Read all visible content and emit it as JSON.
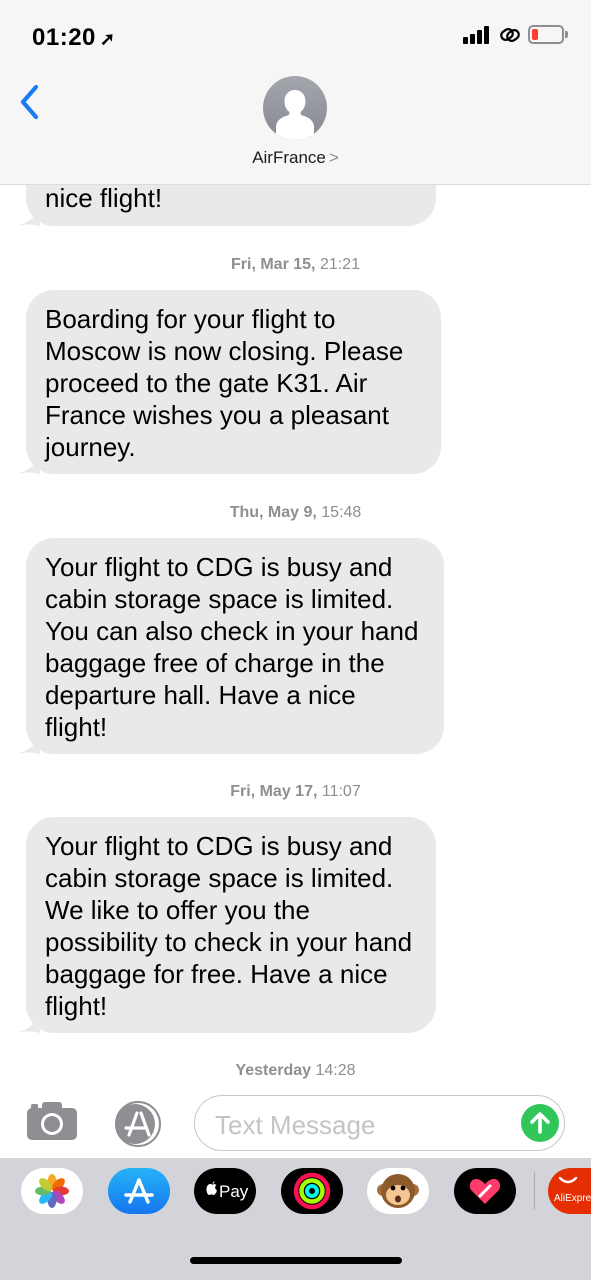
{
  "status_bar": {
    "time": "01:20",
    "location_arrow": "location-arrow-icon",
    "signal": "signal-bars-icon",
    "link": "link-icon",
    "battery_color": "#ff3b30"
  },
  "header": {
    "back": "chevron-left-icon",
    "contact_name": "AirFrance",
    "contact_chevron": ">"
  },
  "conversation": {
    "partial_bubble_text": "nice flight!",
    "messages": [
      {
        "day": "Fri, Mar 15,",
        "time": "21:21",
        "text": "Boarding for your flight to Moscow is now closing. Please proceed to the gate K31. Air France wishes you a pleasant journey."
      },
      {
        "day": "Thu, May 9,",
        "time": "15:48",
        "text": "Your flight to CDG is busy and cabin storage space is limited. You can also check in your hand baggage free of charge in the departure hall. Have a nice flight!"
      },
      {
        "day": "Fri, May 17,",
        "time": "11:07",
        "text": "Your flight to CDG is busy and cabin storage space is limited. We like to offer you the possibility to check in your hand baggage for free. Have a nice flight!"
      }
    ],
    "last_timestamp": {
      "day": "Yesterday",
      "time": "14:28"
    }
  },
  "input_bar": {
    "camera": "camera-icon",
    "apps": "app-store-icon",
    "placeholder": "Text Message",
    "send": "send-arrow-icon",
    "send_color": "#30c65a"
  },
  "app_drawer": {
    "apps": [
      {
        "icon": "photos-app-icon"
      },
      {
        "icon": "app-store-icon"
      },
      {
        "icon": "apple-pay-icon",
        "label": "Pay"
      },
      {
        "icon": "activity-rings-icon"
      },
      {
        "icon": "animoji-monkey-icon"
      },
      {
        "icon": "digital-touch-icon"
      },
      {
        "icon": "aliexpress-icon",
        "label": "AliExpre"
      }
    ]
  }
}
